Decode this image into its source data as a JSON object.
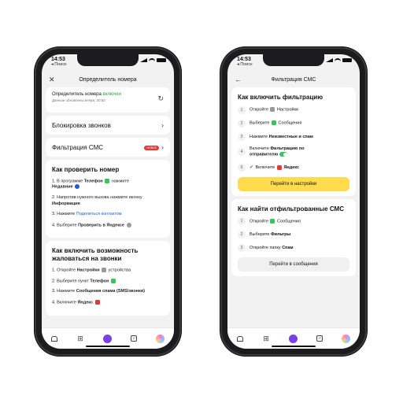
{
  "status": {
    "time": "14:53",
    "back_label": "◂ Поиск"
  },
  "left": {
    "title": "Определитель номера",
    "identifier": {
      "label": "Определитель номера",
      "state": "включен",
      "updated": "Данные обновлены вчера, 20:50"
    },
    "block_calls": "Блокировка звонков",
    "sms_filter": "Фильтрация СМС",
    "sms_badge": "НОВОЕ",
    "check_title": "Как проверить номер",
    "check_steps": [
      {
        "n": "1.",
        "pre": "В программе",
        "bold": "Телефон",
        "post": "нажмите",
        "bold2": "Недавние"
      },
      {
        "n": "2.",
        "pre": "Напротив нужного вызова нажмите иконку",
        "bold": "Информация"
      },
      {
        "n": "3.",
        "pre": "Нажмите",
        "link": "Поделиться контактом"
      },
      {
        "n": "4.",
        "pre": "Выберите",
        "bold": "Проверить в Яндексе"
      }
    ],
    "complain_title": "Как включить возможность жаловаться на звонки",
    "complain_steps": [
      {
        "n": "1.",
        "pre": "Откройте",
        "bold": "Настройки",
        "post": "устройства"
      },
      {
        "n": "2.",
        "pre": "Выберите пункт",
        "bold": "Телефон"
      },
      {
        "n": "3.",
        "pre": "Нажмите",
        "bold": "Сообщения спама (SMS/звонки)"
      },
      {
        "n": "4.",
        "pre": "Включите",
        "bold": "Яндекс"
      }
    ]
  },
  "right": {
    "title": "Фильтрация СМС",
    "enable_title": "Как включить фильтрацию",
    "enable_steps": [
      {
        "n": "1",
        "pre": "Откройте",
        "bold": "Настройки"
      },
      {
        "n": "2",
        "pre": "Выберите",
        "bold": "Сообщения"
      },
      {
        "n": "3",
        "pre": "Нажмите",
        "bold": "Неизвестные и спам"
      },
      {
        "n": "4",
        "pre": "Включите",
        "bold": "Фильтрацию по",
        "line2_bold": "отправителю"
      },
      {
        "n": "5",
        "pre": "Включите",
        "bold": "Яндекс"
      }
    ],
    "go_settings": "Перейти в настройки",
    "find_title": "Как найти отфильтрованные СМС",
    "find_steps": [
      {
        "n": "1",
        "pre": "Откройте",
        "bold": "Сообщения"
      },
      {
        "n": "2",
        "pre": "Выберите",
        "bold": "Фильтры"
      },
      {
        "n": "3",
        "pre": "Откройте папку",
        "bold": "Спам"
      }
    ],
    "go_messages": "Перейти в сообщения"
  },
  "tabbar": {
    "icons": [
      "home-icon",
      "grid-icon",
      "alice-icon",
      "inbox-icon",
      "avatar-icon"
    ],
    "badge": "17"
  },
  "colors": {
    "accent_yellow": "#ffdb4d",
    "green": "#2fa23c",
    "link": "#1e5fd1",
    "alice": "#7b3fe4"
  }
}
